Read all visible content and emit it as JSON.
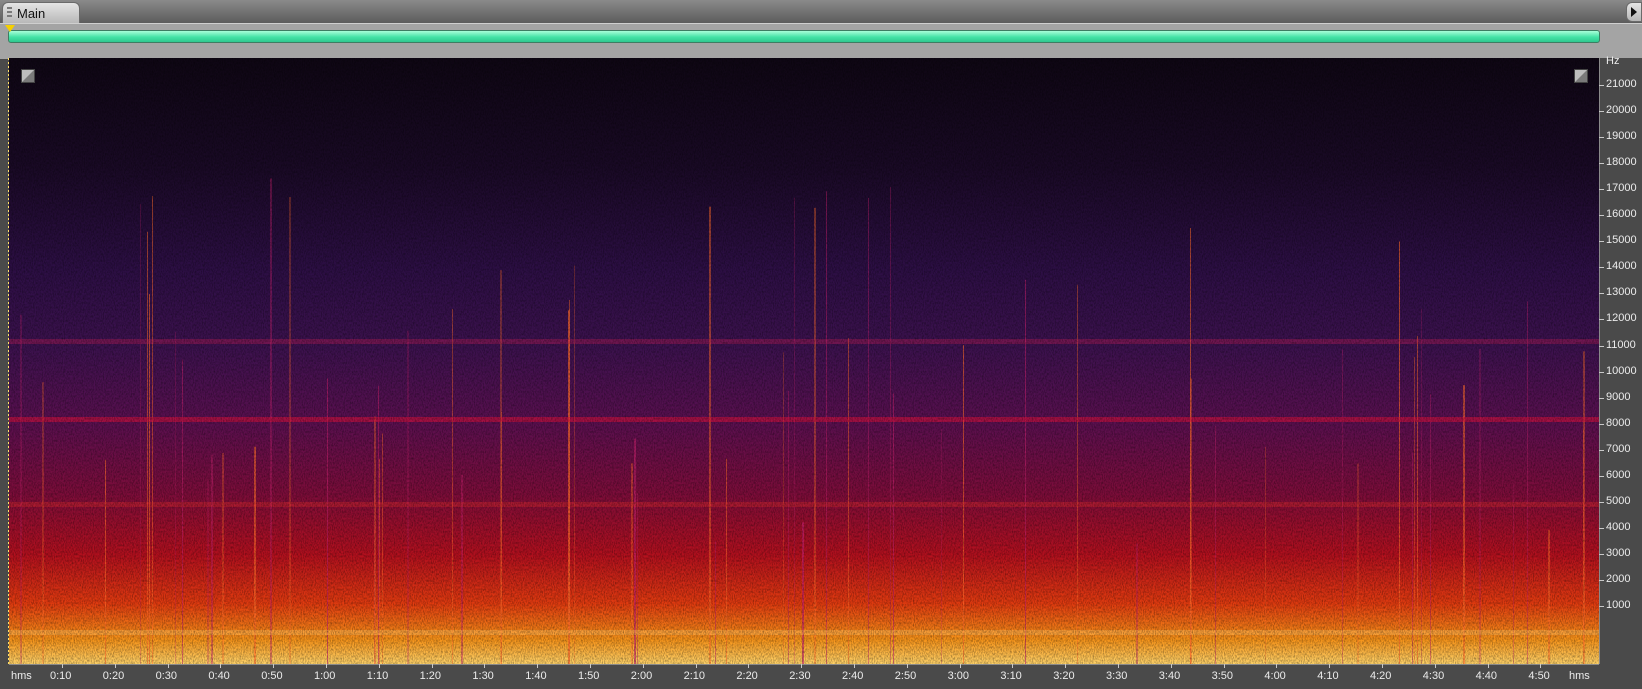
{
  "tab": {
    "label": "Main"
  },
  "y_axis": {
    "unit": "Hz",
    "labels": [
      "21000",
      "20000",
      "19000",
      "18000",
      "17000",
      "16000",
      "15000",
      "14000",
      "13000",
      "12000",
      "11000",
      "10000",
      "9000",
      "8000",
      "7000",
      "6000",
      "5000",
      "4000",
      "3000",
      "2000",
      "1000"
    ]
  },
  "x_axis": {
    "left_unit": "hms",
    "right_unit": "hms",
    "labels": [
      "0:10",
      "0:20",
      "0:30",
      "0:40",
      "0:50",
      "1:00",
      "1:10",
      "1:20",
      "1:30",
      "1:40",
      "1:50",
      "2:00",
      "2:10",
      "2:20",
      "2:30",
      "2:40",
      "2:50",
      "3:00",
      "3:10",
      "3:20",
      "3:30",
      "3:40",
      "3:50",
      "4:00",
      "4:10",
      "4:20",
      "4:30",
      "4:40",
      "4:50"
    ]
  },
  "colors": {
    "range_bar": "#44e3a6",
    "playhead": "#f5d000",
    "background": "#4a4a4a"
  },
  "icons": {
    "zoom_left": "zoom-corner-icon",
    "zoom_right": "zoom-corner-icon",
    "tab_grip": "grip-icon"
  }
}
